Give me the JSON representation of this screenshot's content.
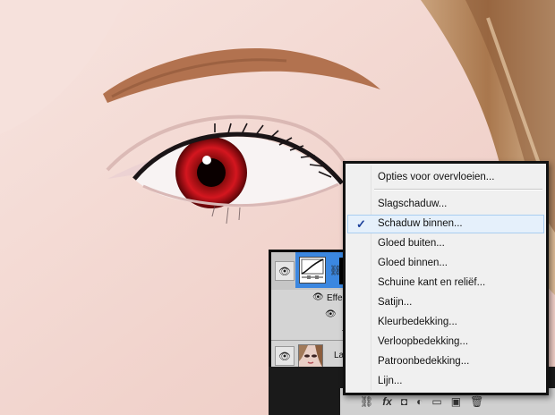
{
  "context_menu": {
    "items": [
      {
        "label": "Opties voor overvloeien...",
        "checked": false
      },
      {
        "label": "Slagschaduw...",
        "checked": false
      },
      {
        "label": "Schaduw binnen...",
        "checked": true
      },
      {
        "label": "Gloed buiten...",
        "checked": false
      },
      {
        "label": "Gloed binnen...",
        "checked": false
      },
      {
        "label": "Schuine kant en reliëf...",
        "checked": false
      },
      {
        "label": "Satijn...",
        "checked": false
      },
      {
        "label": "Kleurbedekking...",
        "checked": false
      },
      {
        "label": "Verloopbedekking...",
        "checked": false
      },
      {
        "label": "Patroonbedekking...",
        "checked": false
      },
      {
        "label": "Lijn...",
        "checked": false
      }
    ],
    "check_mark": "✓"
  },
  "layers_panel": {
    "effects_label": "Effec",
    "layer_name": "Laa",
    "link_glyph": "⛓",
    "eye_glyph": "👁",
    "sub_dots": "· · ·"
  },
  "toolbar": {
    "icons": [
      "link-icon",
      "fx-icon",
      "mask-icon",
      "adjustment-icon",
      "folder-icon",
      "new-layer-icon",
      "trash-icon"
    ],
    "fx_label": "fx",
    "glyphs": [
      "⛓",
      "fx",
      "◘",
      "◐",
      "▭",
      "▣",
      "🗑"
    ]
  },
  "colors": {
    "highlight_bg": "#e5f0fb",
    "selected_layer": "#3b87e0",
    "iris_red": "#c0141b"
  }
}
